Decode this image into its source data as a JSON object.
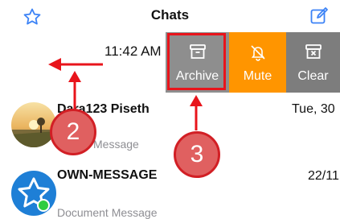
{
  "header": {
    "title": "Chats",
    "left_icon": "star-icon",
    "right_icon": "compose-icon",
    "accent_color": "#3b82f6"
  },
  "swiped_row": {
    "time": "11:42 AM",
    "actions": [
      {
        "label": "Archive",
        "icon": "archive-icon",
        "color": "#8e8e8e"
      },
      {
        "label": "Mute",
        "icon": "bell-off-icon",
        "color": "#ff9500"
      },
      {
        "label": "Clear",
        "icon": "clear-box-icon",
        "color": "#7d7d7d"
      }
    ]
  },
  "chats": [
    {
      "name": "Dara123 Piseth",
      "date": "Tue, 30",
      "preview": "Message"
    },
    {
      "name": "OWN-MESSAGE",
      "date": "22/11",
      "preview": "Document Message"
    }
  ],
  "annotations": {
    "step_a": "2",
    "step_b": "3",
    "highlight_color": "#e8141b"
  }
}
